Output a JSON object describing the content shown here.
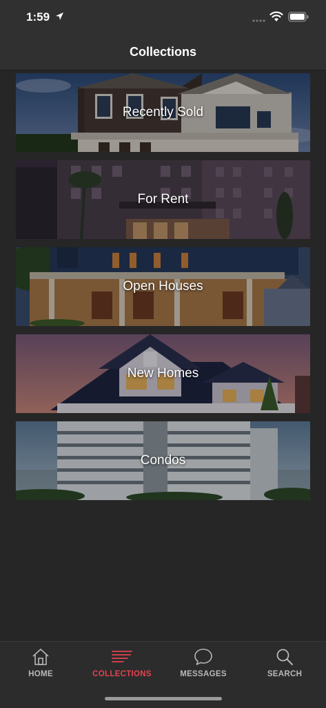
{
  "status_bar": {
    "time": "1:59"
  },
  "header": {
    "title": "Collections"
  },
  "collections": [
    {
      "label": "Recently Sold"
    },
    {
      "label": "For Rent"
    },
    {
      "label": "Open Houses"
    },
    {
      "label": "New Homes"
    },
    {
      "label": "Condos"
    }
  ],
  "tabs": [
    {
      "label": "HOME",
      "icon": "home-icon"
    },
    {
      "label": "COLLECTIONS",
      "icon": "collections-icon",
      "active": true
    },
    {
      "label": "MESSAGES",
      "icon": "message-icon"
    },
    {
      "label": "SEARCH",
      "icon": "search-icon"
    }
  ],
  "colors": {
    "accent": "#e2434f",
    "background": "#262626",
    "bar": "#303030"
  }
}
